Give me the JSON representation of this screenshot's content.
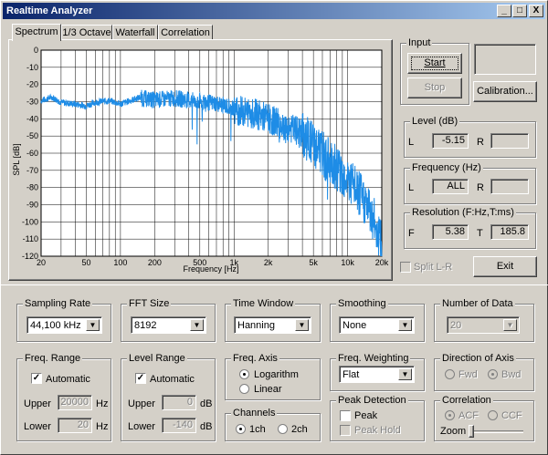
{
  "window": {
    "title": "Realtime Analyzer",
    "min": "_",
    "max": "□",
    "close": "X"
  },
  "tabs": [
    "Spectrum",
    "1/3 Octave",
    "Waterfall",
    "Correlation"
  ],
  "chart_data": {
    "type": "line",
    "ylabel": "SPL [dB]",
    "xlabel": "Frequency [Hz]",
    "x_scale": "log",
    "xlim": [
      20,
      20000
    ],
    "ylim": [
      -120,
      0
    ],
    "yticks": [
      0,
      -10,
      -20,
      -30,
      -40,
      -50,
      -60,
      -70,
      -80,
      -90,
      -100,
      -110,
      -120
    ],
    "xticks": [
      "20",
      "50",
      "100",
      "200",
      "500",
      "1k",
      "2k",
      "5k",
      "10k",
      "20k"
    ],
    "grid": true,
    "series": [
      {
        "color": "#1e8ce6",
        "x": [
          20,
          25,
          30,
          40,
          50,
          60,
          80,
          100,
          150,
          200,
          300,
          500,
          700,
          1000,
          1500,
          2000,
          3000,
          4000,
          5000,
          6000,
          8000,
          10000,
          12000,
          15000,
          18000,
          20000
        ],
        "y": [
          -29,
          -27,
          -30,
          -31,
          -32,
          -30,
          -29,
          -31,
          -27,
          -28,
          -27,
          -29,
          -30,
          -33,
          -35,
          -38,
          -43,
          -47,
          -52,
          -58,
          -65,
          -72,
          -79,
          -88,
          -100,
          -112
        ]
      }
    ]
  },
  "input": {
    "label": "Input",
    "start": "Start",
    "stop": "Stop",
    "calibration": "Calibration..."
  },
  "level": {
    "label": "Level (dB)",
    "L_label": "L",
    "L_value": "-5.15",
    "R_label": "R",
    "R_value": ""
  },
  "frequency": {
    "label": "Frequency (Hz)",
    "L_label": "L",
    "L_value": "ALL",
    "R_label": "R",
    "R_value": ""
  },
  "resolution": {
    "label": "Resolution (F:Hz,T:ms)",
    "F_label": "F",
    "F_value": "5.38",
    "T_label": "T",
    "T_value": "185.8"
  },
  "split_lr": "Split L-R",
  "exit": "Exit",
  "sampling_rate": {
    "label": "Sampling Rate",
    "value": "44,100 kHz"
  },
  "fft_size": {
    "label": "FFT Size",
    "value": "8192"
  },
  "time_window": {
    "label": "Time Window",
    "value": "Hanning"
  },
  "smoothing": {
    "label": "Smoothing",
    "value": "None"
  },
  "number_of_data": {
    "label": "Number of Data",
    "value": "20"
  },
  "freq_range": {
    "label": "Freq. Range",
    "auto": "Automatic",
    "upper_label": "Upper",
    "upper_value": "20000",
    "lower_label": "Lower",
    "lower_value": "20",
    "unit": "Hz"
  },
  "level_range": {
    "label": "Level Range",
    "auto": "Automatic",
    "upper_label": "Upper",
    "upper_value": "0",
    "lower_label": "Lower",
    "lower_value": "-140",
    "unit": "dB"
  },
  "freq_axis": {
    "label": "Freq. Axis",
    "log": "Logarithm",
    "linear": "Linear"
  },
  "channels": {
    "label": "Channels",
    "one": "1ch",
    "two": "2ch"
  },
  "freq_weighting": {
    "label": "Freq. Weighting",
    "value": "Flat"
  },
  "peak_detection": {
    "label": "Peak Detection",
    "peak": "Peak",
    "peak_hold": "Peak Hold"
  },
  "direction_of_axis": {
    "label": "Direction of Axis",
    "fwd": "Fwd",
    "bwd": "Bwd"
  },
  "correlation": {
    "label": "Correlation",
    "acf": "ACF",
    "ccf": "CCF",
    "zoom": "Zoom"
  }
}
